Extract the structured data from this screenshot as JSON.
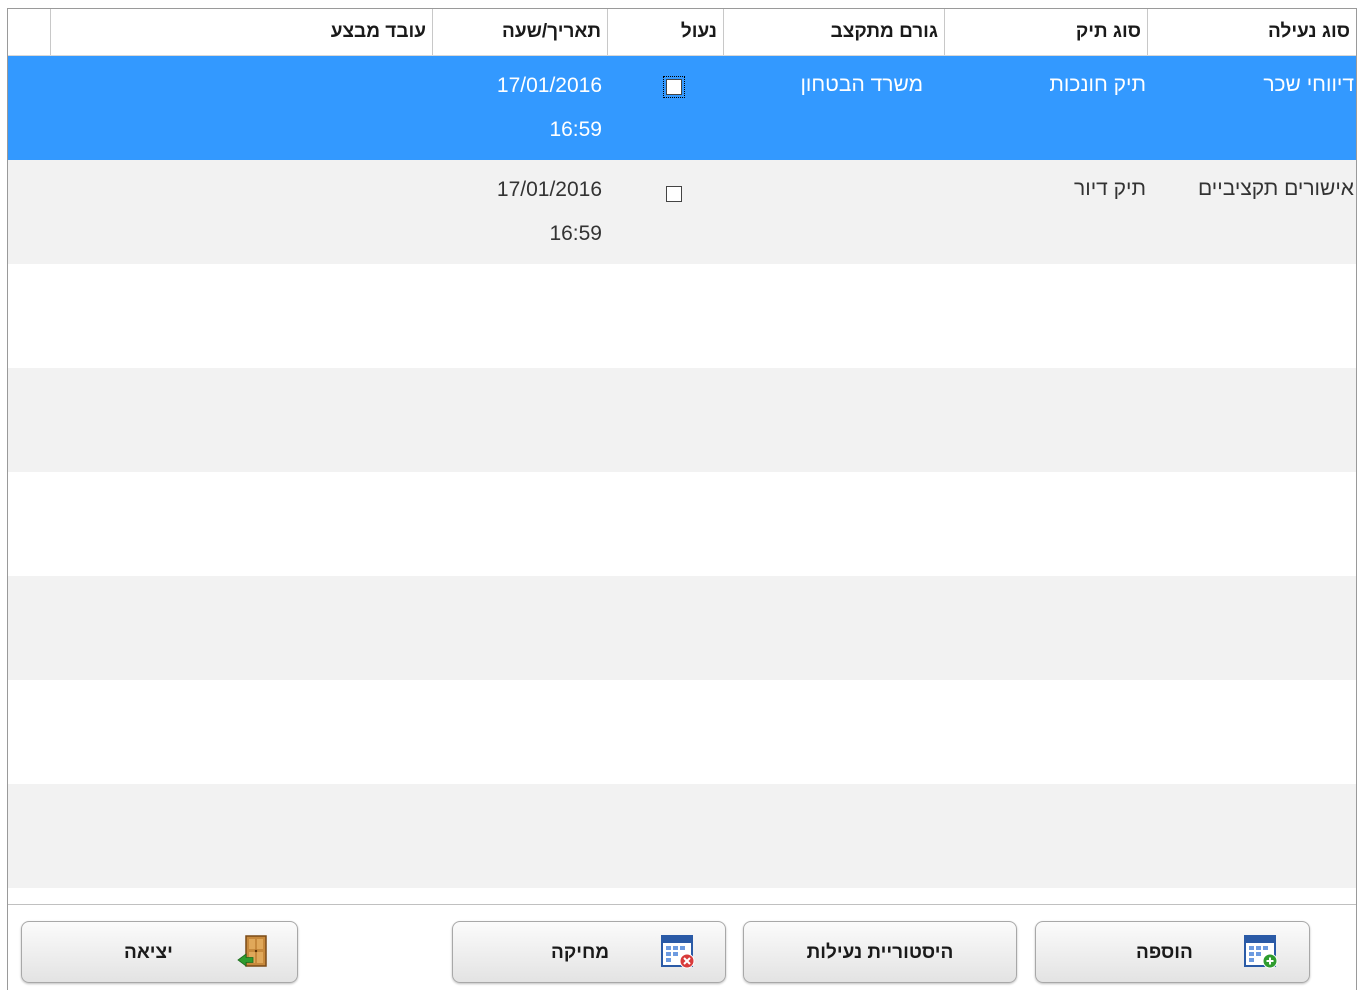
{
  "grid": {
    "columns": [
      {
        "key": "type",
        "label": "סוג נעילה"
      },
      {
        "key": "file",
        "label": "סוג תיק"
      },
      {
        "key": "budget",
        "label": "גורם מתקצב"
      },
      {
        "key": "locked",
        "label": "נעול"
      },
      {
        "key": "datetime",
        "label": "תאריך/שעה"
      },
      {
        "key": "worker",
        "label": "עובד מבצע"
      }
    ],
    "rows": [
      {
        "type": "דיווחי שכר",
        "file": "תיק חונכות",
        "budget": "משרד הבטחון",
        "locked": false,
        "date": "17/01/2016",
        "time": "16:59",
        "worker": "",
        "selected": true
      },
      {
        "type": "אישורים תקציביים",
        "file": "תיק דיור",
        "budget": "",
        "locked": false,
        "date": "17/01/2016",
        "time": "16:59",
        "worker": "",
        "selected": false
      }
    ]
  },
  "toolbar": {
    "add": {
      "label": "הוספה",
      "icon": "calendar-add-icon"
    },
    "history": {
      "label": "היסטוריית נעילות"
    },
    "delete": {
      "label": "מחיקה",
      "icon": "calendar-delete-icon"
    },
    "exit": {
      "label": "יציאה",
      "icon": "exit-door-icon"
    }
  },
  "colors": {
    "selected": "#3399ff",
    "stripe": "#f2f2f2"
  }
}
